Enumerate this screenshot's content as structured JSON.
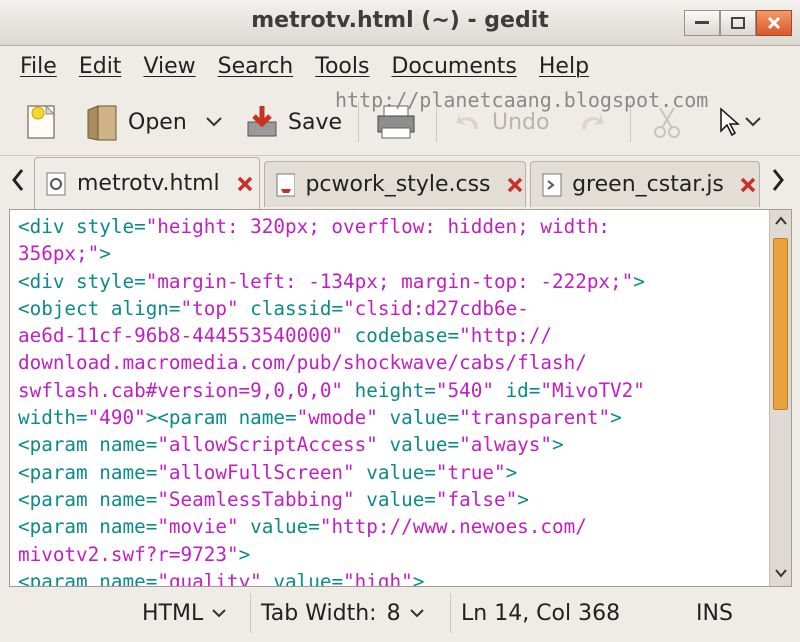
{
  "window": {
    "title": "metrotv.html (~) - gedit"
  },
  "menu": [
    "File",
    "Edit",
    "View",
    "Search",
    "Tools",
    "Documents",
    "Help"
  ],
  "toolbar": {
    "open_label": "Open",
    "save_label": "Save",
    "undo_label": "Undo",
    "watermark": "http://planetcaang.blogspot.com"
  },
  "tabs": [
    {
      "label": "metrotv.html",
      "active": true
    },
    {
      "label": "pcwork_style.css",
      "active": false
    },
    {
      "label": "green_cstar.js",
      "active": false
    }
  ],
  "code_lines": [
    [
      [
        "t",
        "<div style="
      ],
      [
        "v",
        "\"height: 320px; overflow: hidden; width:"
      ]
    ],
    [
      [
        "v",
        "356px;\""
      ],
      [
        "t",
        ">"
      ]
    ],
    [
      [
        "t",
        "<div style="
      ],
      [
        "v",
        "\"margin-left: -134px; margin-top: -222px;\""
      ],
      [
        "t",
        ">"
      ]
    ],
    [
      [
        "t",
        "<object align="
      ],
      [
        "v",
        "\"top\""
      ],
      [
        "t",
        " classid="
      ],
      [
        "v",
        "\"clsid:d27cdb6e-"
      ]
    ],
    [
      [
        "v",
        "ae6d-11cf-96b8-444553540000\""
      ],
      [
        "t",
        " codebase="
      ],
      [
        "v",
        "\"http://"
      ]
    ],
    [
      [
        "v",
        "download.macromedia.com/pub/shockwave/cabs/flash/"
      ]
    ],
    [
      [
        "v",
        "swflash.cab#version=9,0,0,0\""
      ],
      [
        "t",
        " height="
      ],
      [
        "v",
        "\"540\""
      ],
      [
        "t",
        " id="
      ],
      [
        "v",
        "\"MivoTV2\""
      ]
    ],
    [
      [
        "t",
        "width="
      ],
      [
        "v",
        "\"490\""
      ],
      [
        "t",
        "><param name="
      ],
      [
        "v",
        "\"wmode\""
      ],
      [
        "t",
        " value="
      ],
      [
        "v",
        "\"transparent\""
      ],
      [
        "t",
        ">"
      ]
    ],
    [
      [
        "t",
        "<param name="
      ],
      [
        "v",
        "\"allowScriptAccess\""
      ],
      [
        "t",
        " value="
      ],
      [
        "v",
        "\"always\""
      ],
      [
        "t",
        ">"
      ]
    ],
    [
      [
        "t",
        "<param name="
      ],
      [
        "v",
        "\"allowFullScreen\""
      ],
      [
        "t",
        " value="
      ],
      [
        "v",
        "\"true\""
      ],
      [
        "t",
        ">"
      ]
    ],
    [
      [
        "t",
        "<param name="
      ],
      [
        "v",
        "\"SeamlessTabbing\""
      ],
      [
        "t",
        " value="
      ],
      [
        "v",
        "\"false\""
      ],
      [
        "t",
        ">"
      ]
    ],
    [
      [
        "t",
        "<param name="
      ],
      [
        "v",
        "\"movie\""
      ],
      [
        "t",
        " value="
      ],
      [
        "v",
        "\"http://www.newoes.com/"
      ]
    ],
    [
      [
        "v",
        "mivotv2.swf?r=9723\""
      ],
      [
        "t",
        ">"
      ]
    ],
    [
      [
        "t",
        "<param name="
      ],
      [
        "v",
        "\"quality\""
      ],
      [
        "t",
        " value="
      ],
      [
        "v",
        "\"high\""
      ],
      [
        "t",
        ">"
      ]
    ]
  ],
  "status": {
    "language": "HTML",
    "tab_width_label": "Tab Width:",
    "tab_width_value": "8",
    "position": "Ln 14, Col 368",
    "mode": "INS"
  },
  "colors": {
    "tag": "#0b8a8a",
    "value": "#c21fc2",
    "close_accent": "#d7572a"
  }
}
